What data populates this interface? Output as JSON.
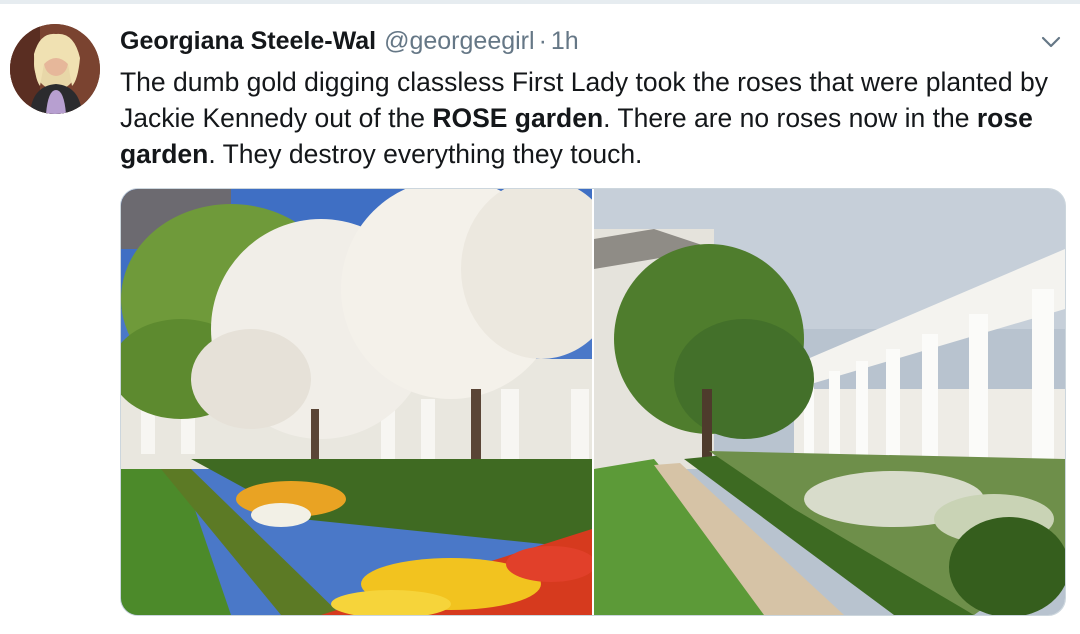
{
  "tweet": {
    "author_name": "Georgiana Steele-Wal",
    "handle": "@georgeegirl",
    "separator": "·",
    "time": "1h",
    "text_parts": {
      "p1": "The dumb gold digging classless First Lady took the roses that were planted by Jackie Kennedy out of the ",
      "b1": "ROSE garden",
      "p2": ". There are no roses now in the ",
      "b2": "rose garden",
      "p3": ". They destroy everything they touch."
    }
  },
  "icons": {
    "menu": "chevron-down-icon"
  },
  "colors": {
    "text_primary": "#14171a",
    "text_secondary": "#657786",
    "border": "#ccd6dd"
  }
}
